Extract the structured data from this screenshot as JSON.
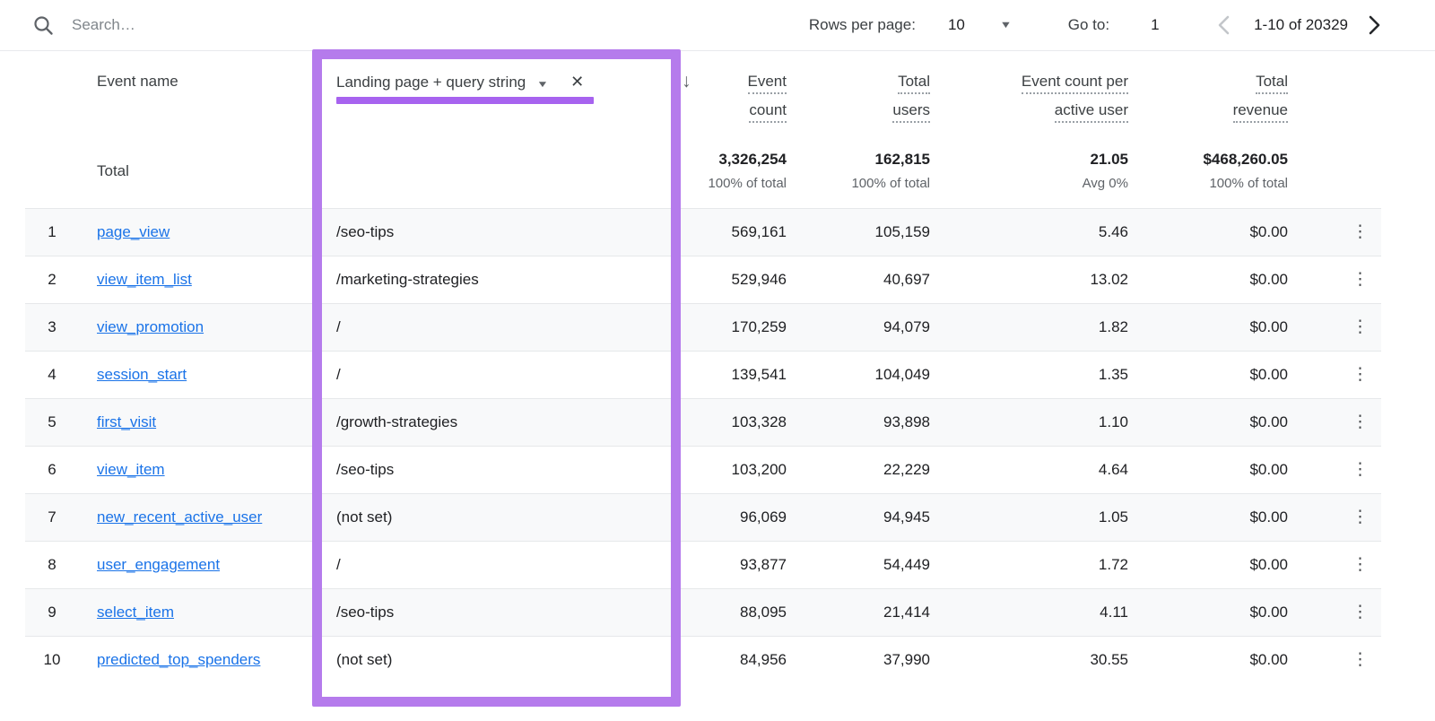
{
  "topbar": {
    "search_placeholder": "Search…",
    "rows_per_page_label": "Rows per page:",
    "rows_per_page_value": "10",
    "goto_label": "Go to:",
    "goto_value": "1",
    "pagination_range": "1-10 of 20329"
  },
  "header": {
    "event_name": "Event name",
    "secondary_dimension": "Landing page + query string",
    "metrics": [
      {
        "line1": "Event",
        "line2": "count"
      },
      {
        "line1": "Total",
        "line2": "users"
      },
      {
        "line1": "Event count per",
        "line2": "active user"
      },
      {
        "line1": "Total",
        "line2": "revenue"
      }
    ]
  },
  "totals": {
    "label": "Total",
    "event_count": "3,326,254",
    "event_count_sub": "100% of total",
    "total_users": "162,815",
    "total_users_sub": "100% of total",
    "per_active_user": "21.05",
    "per_active_user_sub": "Avg 0%",
    "revenue": "$468,260.05",
    "revenue_sub": "100% of total"
  },
  "rows": [
    {
      "num": "1",
      "event": "page_view",
      "landing": "/seo-tips",
      "event_count": "569,161",
      "total_users": "105,159",
      "per_active_user": "5.46",
      "revenue": "$0.00"
    },
    {
      "num": "2",
      "event": "view_item_list",
      "landing": "/marketing-strategies",
      "event_count": "529,946",
      "total_users": "40,697",
      "per_active_user": "13.02",
      "revenue": "$0.00"
    },
    {
      "num": "3",
      "event": "view_promotion",
      "landing": "/",
      "event_count": "170,259",
      "total_users": "94,079",
      "per_active_user": "1.82",
      "revenue": "$0.00"
    },
    {
      "num": "4",
      "event": "session_start",
      "landing": "/",
      "event_count": "139,541",
      "total_users": "104,049",
      "per_active_user": "1.35",
      "revenue": "$0.00"
    },
    {
      "num": "5",
      "event": "first_visit",
      "landing": "/growth-strategies",
      "event_count": "103,328",
      "total_users": "93,898",
      "per_active_user": "1.10",
      "revenue": "$0.00"
    },
    {
      "num": "6",
      "event": "view_item",
      "landing": "/seo-tips",
      "event_count": "103,200",
      "total_users": "22,229",
      "per_active_user": "4.64",
      "revenue": "$0.00"
    },
    {
      "num": "7",
      "event": "new_recent_active_user",
      "landing": "(not set)",
      "event_count": "96,069",
      "total_users": "94,945",
      "per_active_user": "1.05",
      "revenue": "$0.00"
    },
    {
      "num": "8",
      "event": "user_engagement",
      "landing": "/",
      "event_count": "93,877",
      "total_users": "54,449",
      "per_active_user": "1.72",
      "revenue": "$0.00"
    },
    {
      "num": "9",
      "event": "select_item",
      "landing": "/seo-tips",
      "event_count": "88,095",
      "total_users": "21,414",
      "per_active_user": "4.11",
      "revenue": "$0.00"
    },
    {
      "num": "10",
      "event": "predicted_top_spenders",
      "landing": "(not set)",
      "event_count": "84,956",
      "total_users": "37,990",
      "per_active_user": "30.55",
      "revenue": "$0.00"
    }
  ],
  "icons": {
    "kebab_glyph": "⋮",
    "sort_arrow_glyph": "↓",
    "dropdown_caret_glyph": "▼",
    "close_glyph": "✕"
  },
  "colors": {
    "highlight_purple_box": "#b57bec",
    "highlight_purple_underline": "#a763ef",
    "link_blue": "#1a73e8",
    "row_stripe": "#f8f9fa",
    "header_gray": "#3c4043",
    "muted_gray": "#5f6368"
  }
}
